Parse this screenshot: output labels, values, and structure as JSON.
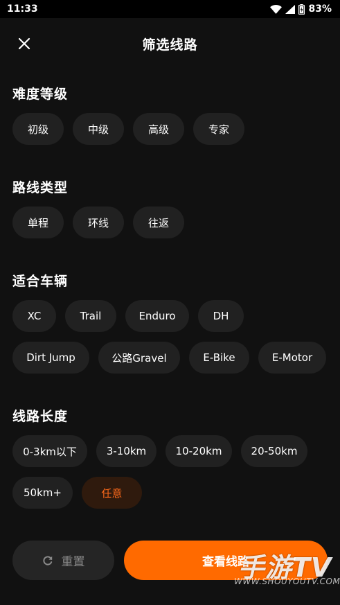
{
  "status_bar": {
    "time": "11:33",
    "battery": "83%"
  },
  "header": {
    "title": "筛选线路",
    "close_icon": "close-icon"
  },
  "sections": {
    "difficulty": {
      "title": "难度等级",
      "options": [
        "初级",
        "中级",
        "高级",
        "专家"
      ]
    },
    "route_type": {
      "title": "路线类型",
      "options": [
        "单程",
        "环线",
        "往返"
      ]
    },
    "vehicle": {
      "title": "适合车辆",
      "row1": [
        "XC",
        "Trail",
        "Enduro",
        "DH"
      ],
      "row2": [
        "Dirt Jump",
        "公路Gravel",
        "E-Bike",
        "E-Motor"
      ]
    },
    "length": {
      "title": "线路长度",
      "row1": [
        "0-3km以下",
        "3-10km",
        "10-20km",
        "20-50km"
      ],
      "row2": [
        "50km+",
        "任意"
      ],
      "selected": "任意"
    }
  },
  "footer": {
    "reset_label": "重置",
    "reset_icon": "refresh-icon",
    "view_label": "查看线路"
  },
  "watermark": {
    "big": "手游TV",
    "small": "WWW.SHOUYOUTV.COM"
  },
  "colors": {
    "accent": "#ff6a00",
    "chip_bg": "#212121",
    "selected_bg": "#2f1a0d",
    "background": "#111111"
  }
}
